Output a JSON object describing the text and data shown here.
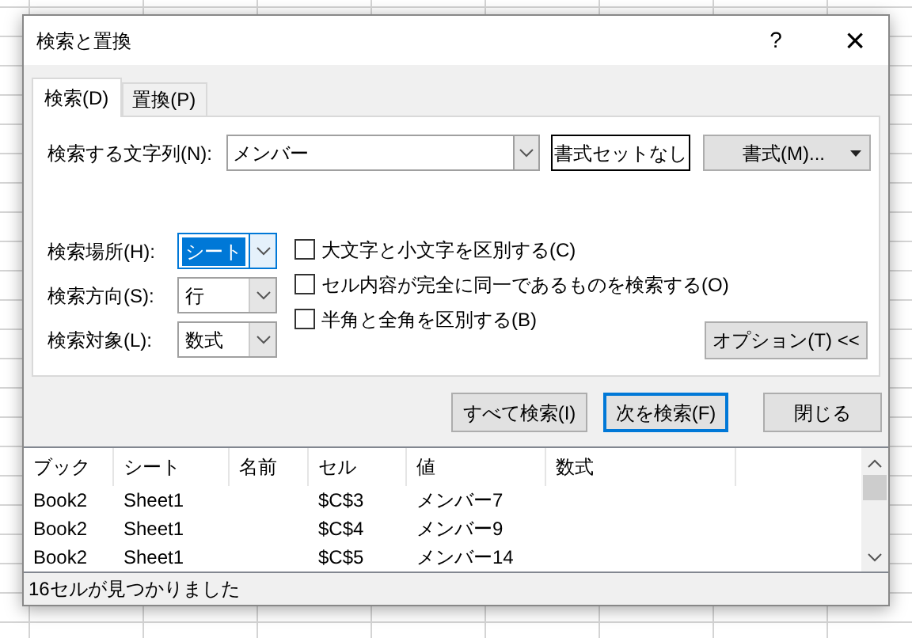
{
  "window": {
    "title": "検索と置換",
    "help": "?",
    "close": "×"
  },
  "tabs": [
    {
      "label": "検索(D)",
      "selected": true
    },
    {
      "label": "置換(P)",
      "selected": false
    }
  ],
  "find_what": {
    "label": "検索する文字列(N):",
    "value": "メンバー"
  },
  "format_status": "書式セットなし",
  "format_button": "書式(M)...",
  "search_options": [
    {
      "label": "検索場所(H):",
      "value": "シート",
      "selected": true
    },
    {
      "label": "検索方向(S):",
      "value": "行",
      "selected": false
    },
    {
      "label": "検索対象(L):",
      "value": "数式",
      "selected": false
    }
  ],
  "checkboxes": [
    {
      "label": "大文字と小文字を区別する(C)",
      "checked": false
    },
    {
      "label": "セル内容が完全に同一であるものを検索する(O)",
      "checked": false
    },
    {
      "label": "半角と全角を区別する(B)",
      "checked": false
    }
  ],
  "options_button": "オプション(T) <<",
  "buttons": [
    {
      "label": "すべて検索(I)",
      "default": false
    },
    {
      "label": "次を検索(F)",
      "default": true
    },
    {
      "label": "閉じる",
      "default": false
    }
  ],
  "results": {
    "columns": [
      "ブック",
      "シート",
      "名前",
      "セル",
      "値",
      "数式"
    ],
    "rows": [
      {
        "book": "Book2",
        "sheet": "Sheet1",
        "cell": "$C$3",
        "value": "メンバー7"
      },
      {
        "book": "Book2",
        "sheet": "Sheet1",
        "cell": "$C$4",
        "value": "メンバー9"
      },
      {
        "book": "Book2",
        "sheet": "Sheet1",
        "cell": "$C$5",
        "value": "メンバー14"
      }
    ]
  },
  "status_bar": "16セルが見つかりました"
}
